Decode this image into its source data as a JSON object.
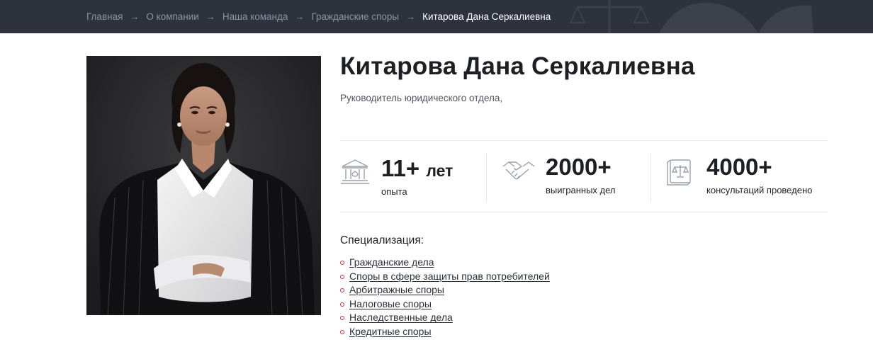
{
  "breadcrumb": {
    "items": [
      "Главная",
      "О компании",
      "Наша команда",
      "Гражданские споры"
    ],
    "current": "Китарова Дана Серкалиевна",
    "separator": "→"
  },
  "profile": {
    "name": "Китарова Дана Серкалиевна",
    "role": "Руководитель юридического отдела,"
  },
  "stats": [
    {
      "icon": "courthouse-icon",
      "value": "11+",
      "unit": "лет",
      "caption": "опыта"
    },
    {
      "icon": "handshake-icon",
      "value": "2000+",
      "unit": "",
      "caption": "выигранных дел"
    },
    {
      "icon": "law-book-icon",
      "value": "4000+",
      "unit": "",
      "caption": "консультаций проведено"
    }
  ],
  "specialization": {
    "title": "Специализация:",
    "items": [
      "Гражданские дела",
      "Споры в сфере защиты прав потребителей",
      "Арбитражные споры",
      "Налоговые споры",
      "Наследственные дела",
      "Кредитные споры"
    ]
  },
  "colors": {
    "header_bg": "#2e323d",
    "accent_bullet": "#c7303c",
    "text": "#1d1f24"
  }
}
